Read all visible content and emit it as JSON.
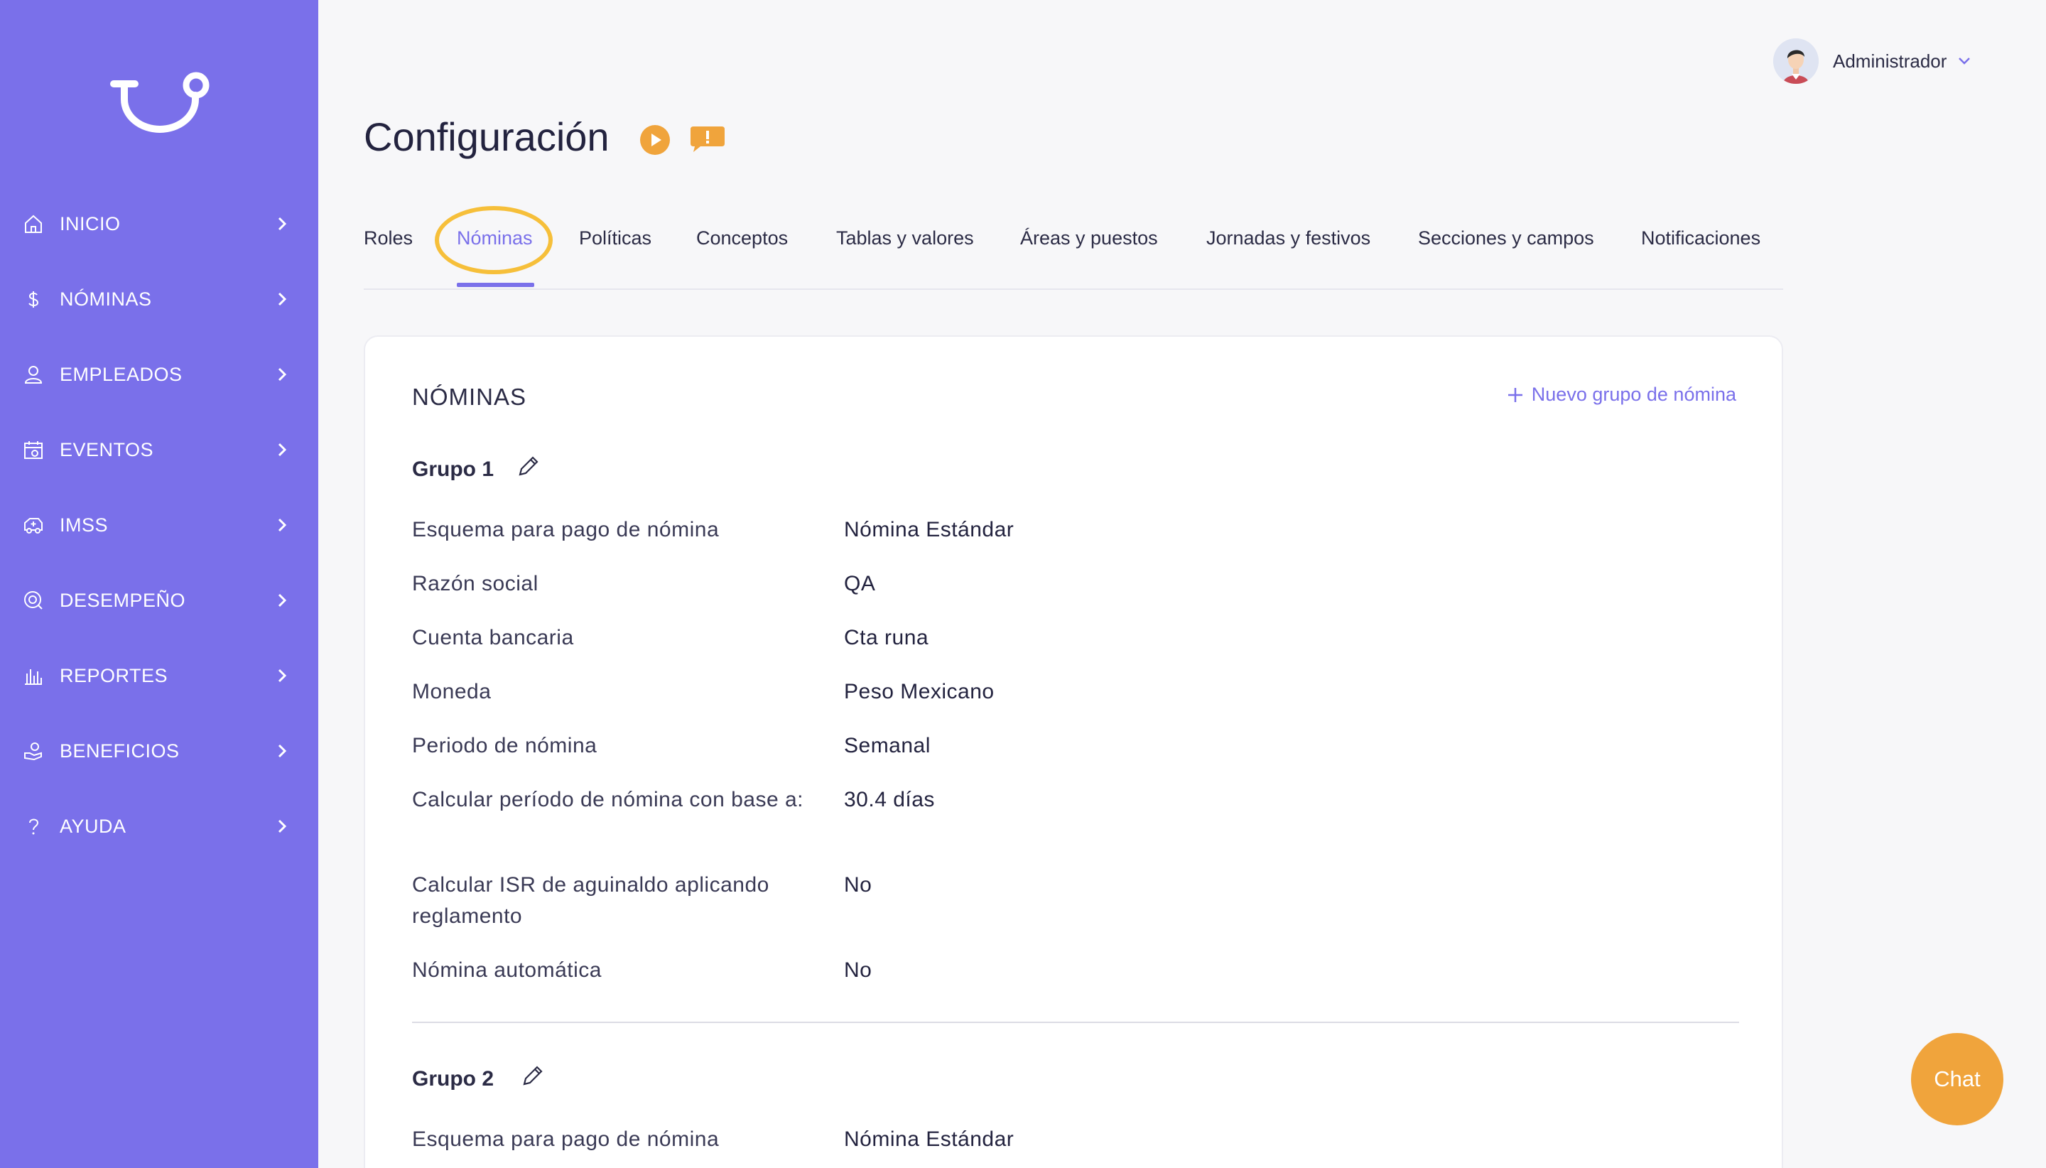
{
  "sidebar": {
    "logo_icon": "logo-icon",
    "items": [
      {
        "label": "INICIO",
        "icon": "home-icon"
      },
      {
        "label": "NÓMINAS",
        "icon": "dollar-icon"
      },
      {
        "label": "EMPLEADOS",
        "icon": "person-icon"
      },
      {
        "label": "EVENTOS",
        "icon": "calendar-icon"
      },
      {
        "label": "IMSS",
        "icon": "ambulance-icon"
      },
      {
        "label": "DESEMPEÑO",
        "icon": "performance-icon"
      },
      {
        "label": "REPORTES",
        "icon": "bar-chart-icon"
      },
      {
        "label": "BENEFICIOS",
        "icon": "benefits-icon"
      },
      {
        "label": "AYUDA",
        "icon": "help-icon"
      }
    ]
  },
  "header": {
    "user_name": "Administrador",
    "page_title": "Configuración"
  },
  "tabs": [
    {
      "label": "Roles"
    },
    {
      "label": "Nóminas",
      "active": true
    },
    {
      "label": "Políticas"
    },
    {
      "label": "Conceptos"
    },
    {
      "label": "Tablas y valores"
    },
    {
      "label": "Áreas y puestos"
    },
    {
      "label": "Jornadas y festivos"
    },
    {
      "label": "Secciones y campos"
    },
    {
      "label": "Notificaciones"
    }
  ],
  "card": {
    "title": "NÓMINAS",
    "new_group_label": "Nuevo grupo de nómina",
    "groups": [
      {
        "name": "Grupo 1",
        "fields": [
          {
            "label": "Esquema para pago de nómina",
            "value": "Nómina Estándar"
          },
          {
            "label": "Razón social",
            "value": "QA"
          },
          {
            "label": "Cuenta bancaria",
            "value": "Cta runa"
          },
          {
            "label": "Moneda",
            "value": "Peso Mexicano"
          },
          {
            "label": "Periodo de nómina",
            "value": "Semanal"
          },
          {
            "label": "Calcular período de nómina con base a:",
            "value": "30.4 días"
          },
          {
            "label": "Calcular ISR de aguinaldo aplicando reglamento",
            "value": "No"
          },
          {
            "label": "Nómina automática",
            "value": "No"
          }
        ]
      },
      {
        "name": "Grupo 2",
        "fields": [
          {
            "label": "Esquema para pago de nómina",
            "value": "Nómina Estándar"
          }
        ]
      }
    ]
  },
  "chat": {
    "label": "Chat"
  },
  "colors": {
    "sidebar": "#7a70ea",
    "accent": "#7a70ea",
    "highlight": "#f6bf3a",
    "chat": "#f0a43c"
  }
}
